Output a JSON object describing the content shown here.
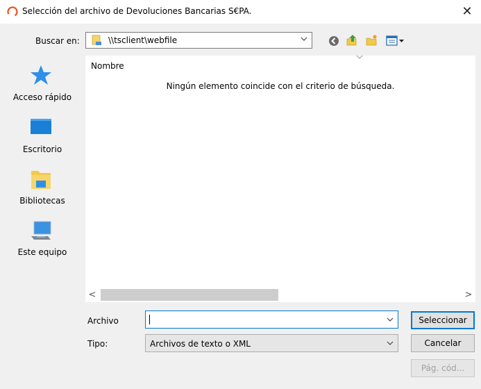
{
  "window": {
    "title": "Selección del archivo de Devoluciones Bancarias S€PA.",
    "close_glyph": "✕"
  },
  "toolbar": {
    "look_in_label": "Buscar en:",
    "look_in_value": "\\\\tsclient\\webfile",
    "icons": [
      "back-icon",
      "up-folder-icon",
      "new-folder-icon",
      "view-menu-icon"
    ]
  },
  "places": [
    {
      "label": "Acceso rápido",
      "icon": "quick-access-star-icon"
    },
    {
      "label": "Escritorio",
      "icon": "desktop-icon"
    },
    {
      "label": "Bibliotecas",
      "icon": "libraries-icon"
    },
    {
      "label": "Este equipo",
      "icon": "this-pc-icon"
    }
  ],
  "file_list": {
    "column_header": "Nombre",
    "empty_message": "Ningún elemento coincide con el criterio de búsqueda.",
    "scroll_left": "<",
    "scroll_right": ">"
  },
  "form": {
    "file_label": "Archivo",
    "file_value": "",
    "type_label": "Tipo:",
    "type_value": "Archivos de texto o XML"
  },
  "buttons": {
    "select": "Seleccionar",
    "cancel": "Cancelar",
    "codepage": "Pág. cód..."
  },
  "colors": {
    "accent": "#0078d7",
    "window_bg": "#f0f0f0",
    "star": "#2f8fe8",
    "folder": "#f2c94c"
  }
}
